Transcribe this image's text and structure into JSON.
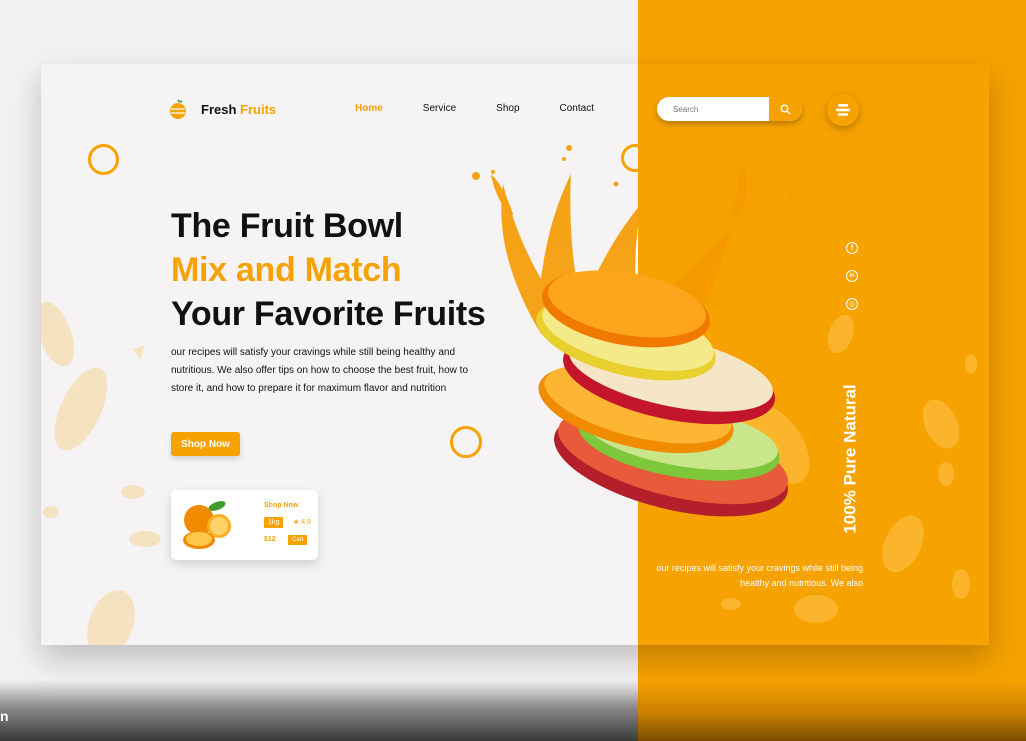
{
  "brand": {
    "name_part1": "Fresh",
    "name_part2": "Fruits"
  },
  "nav": {
    "items": [
      {
        "label": "Home",
        "active": true
      },
      {
        "label": "Service",
        "active": false
      },
      {
        "label": "Shop",
        "active": false
      },
      {
        "label": "Contact",
        "active": false
      }
    ]
  },
  "search": {
    "placeholder": "Search",
    "icon": "search-icon"
  },
  "menu": {
    "icon": "menu-icon"
  },
  "hero": {
    "line1": "The Fruit Bowl",
    "line2": "Mix and Match",
    "line3": "Your Favorite Fruits",
    "description": "our recipes will satisfy your cravings while still being healthy and nutritious. We also offer tips on how to choose the best fruit, how to store it, and how to prepare it for maximum flavor and nutrition",
    "cta": "Shop Now"
  },
  "product_card": {
    "title": "Shop Now",
    "weight": "1kg",
    "rating": "★ 4.9",
    "price": "$12",
    "cart": "Cart"
  },
  "socials": [
    {
      "icon": "facebook-icon",
      "glyph": "f"
    },
    {
      "icon": "linkedin-icon",
      "glyph": "in"
    },
    {
      "icon": "instagram-icon",
      "glyph": "◎"
    }
  ],
  "side_tag": "100% Pure Natural",
  "side_description": "our recipes will satisfy your cravings while still being healthy and nutritious. We also",
  "stray_letter": "n",
  "colors": {
    "accent": "#f6a200",
    "text": "#111111",
    "background": "#f3f2f2"
  }
}
